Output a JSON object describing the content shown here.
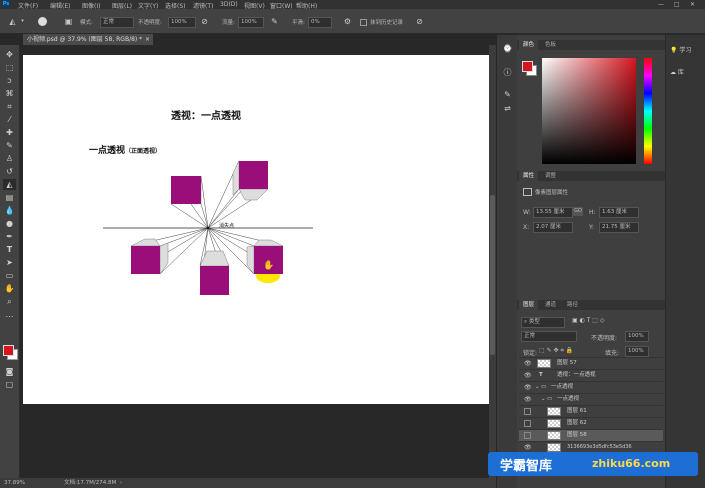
{
  "menu": [
    "文件(F)",
    "编辑(E)",
    "图像(I)",
    "图层(L)",
    "文字(Y)",
    "选择(S)",
    "滤镜(T)",
    "3D(D)",
    "视图(V)",
    "窗口(W)",
    "帮助(H)"
  ],
  "options": {
    "mode_label": "模式:",
    "mode_value": "正常",
    "opacity_label": "不透明度:",
    "opacity_value": "100%",
    "flow_label": "流量:",
    "flow_value": "100%",
    "smooth_label": "平滑:",
    "smooth_value": "0%",
    "erase_history": "抹到历史记录"
  },
  "document": {
    "tab_title": "小视频.psd @ 37.9% (图层 58, RGB/8) *",
    "close": "×"
  },
  "canvas": {
    "title": "透视：一点透视",
    "subtitle": "一点透视",
    "subtitle_small": "（正面透视）",
    "vp_label": "消失点"
  },
  "status": {
    "zoom": "37.89%",
    "doc": "文档:17.7M/274.8M"
  },
  "color_panel": {
    "tab1": "颜色",
    "tab2": "色板",
    "foreground": "#d6161f"
  },
  "properties_panel": {
    "tab1": "属性",
    "tab2": "调整",
    "layer_type": "像素图层属性",
    "w_label": "W:",
    "w_value": "13.55 厘米",
    "h_label": "H:",
    "h_value": "1.63 厘米",
    "x_label": "X:",
    "x_value": "2.07 厘米",
    "y_label": "Y:",
    "y_value": "21.75 厘米",
    "link": "GO"
  },
  "layers_panel": {
    "tab1": "图层",
    "tab2": "通道",
    "tab3": "路径",
    "kind": "类型",
    "blend": "正常",
    "opacity_label": "不透明度:",
    "opacity_value": "100%",
    "lock_label": "锁定:",
    "fill_label": "填充:",
    "fill_value": "100%",
    "layers": [
      {
        "name": "图层 57",
        "type": "pixel",
        "indent": 0,
        "visible": true
      },
      {
        "name": "透视：一点透视",
        "type": "text",
        "indent": 0,
        "visible": true
      },
      {
        "name": "一点透视",
        "type": "folder",
        "indent": 0,
        "visible": true
      },
      {
        "name": "一点透视",
        "type": "folder",
        "indent": 1,
        "visible": true
      },
      {
        "name": "图层 61",
        "type": "pixel",
        "indent": 2,
        "visible": false
      },
      {
        "name": "图层 62",
        "type": "pixel",
        "indent": 2,
        "visible": false
      },
      {
        "name": "图层 58",
        "type": "pixel",
        "indent": 2,
        "visible": false,
        "selected": true
      },
      {
        "name": "3136693e3d5dfc53e5d36",
        "type": "pixel",
        "indent": 2,
        "visible": true
      }
    ]
  },
  "right_panel": {
    "learn": "学习",
    "library": "库"
  },
  "watermark": {
    "text": "学霸智库",
    "url": "zhiku66.com"
  },
  "colors": {
    "cube": "#990e79",
    "highlight": "#ffe800"
  },
  "window_buttons": {
    "minimize": "—",
    "restore": "□",
    "close": "✕"
  }
}
